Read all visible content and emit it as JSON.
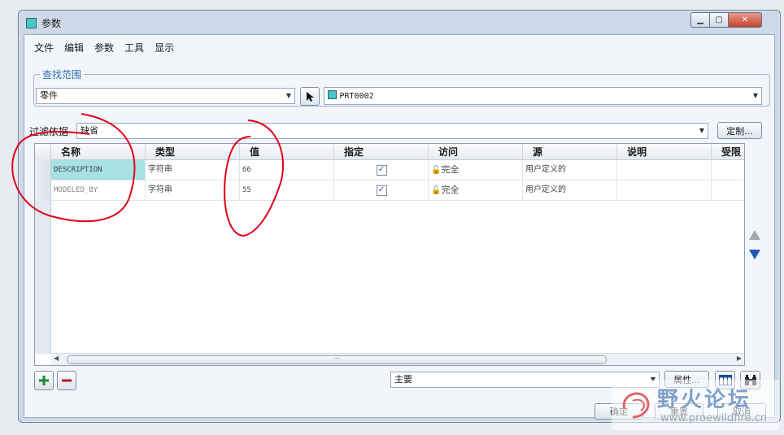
{
  "window": {
    "title": "参数"
  },
  "menu": {
    "items": [
      "文件",
      "编辑",
      "参数",
      "工具",
      "显示"
    ]
  },
  "scope": {
    "group_title": "查找范围",
    "type_value": "零件",
    "object_value": "PRT0002"
  },
  "filter": {
    "label": "过滤依据",
    "value": "缺省",
    "customize_label": "定制..."
  },
  "table": {
    "columns": [
      "名称",
      "类型",
      "值",
      "指定",
      "访问",
      "源",
      "说明",
      "受限"
    ],
    "rows": [
      {
        "name": "DESCRIPTION",
        "type": "字符串",
        "value": "66",
        "designated": true,
        "access": "完全",
        "source": "用户定义的",
        "description": "",
        "restricted": ""
      },
      {
        "name": "MODELED_BY",
        "type": "字符串",
        "value": "55",
        "designated": true,
        "access": "完全",
        "source": "用户定义的",
        "description": "",
        "restricted": ""
      }
    ],
    "scroll_thumb": "⋯"
  },
  "bottom": {
    "main_combo_value": "主要",
    "properties_label": "属性..."
  },
  "actions": {
    "ok_label": "确定",
    "reset_label": "重置",
    "cancel_label": "取消"
  },
  "watermark": {
    "text": "野火论坛",
    "url": "www.proewildfire.cn"
  },
  "colors": {
    "selected_cell": "#a6e1e4",
    "group_title": "#2f6fb2",
    "annotation": "#e0001b"
  }
}
